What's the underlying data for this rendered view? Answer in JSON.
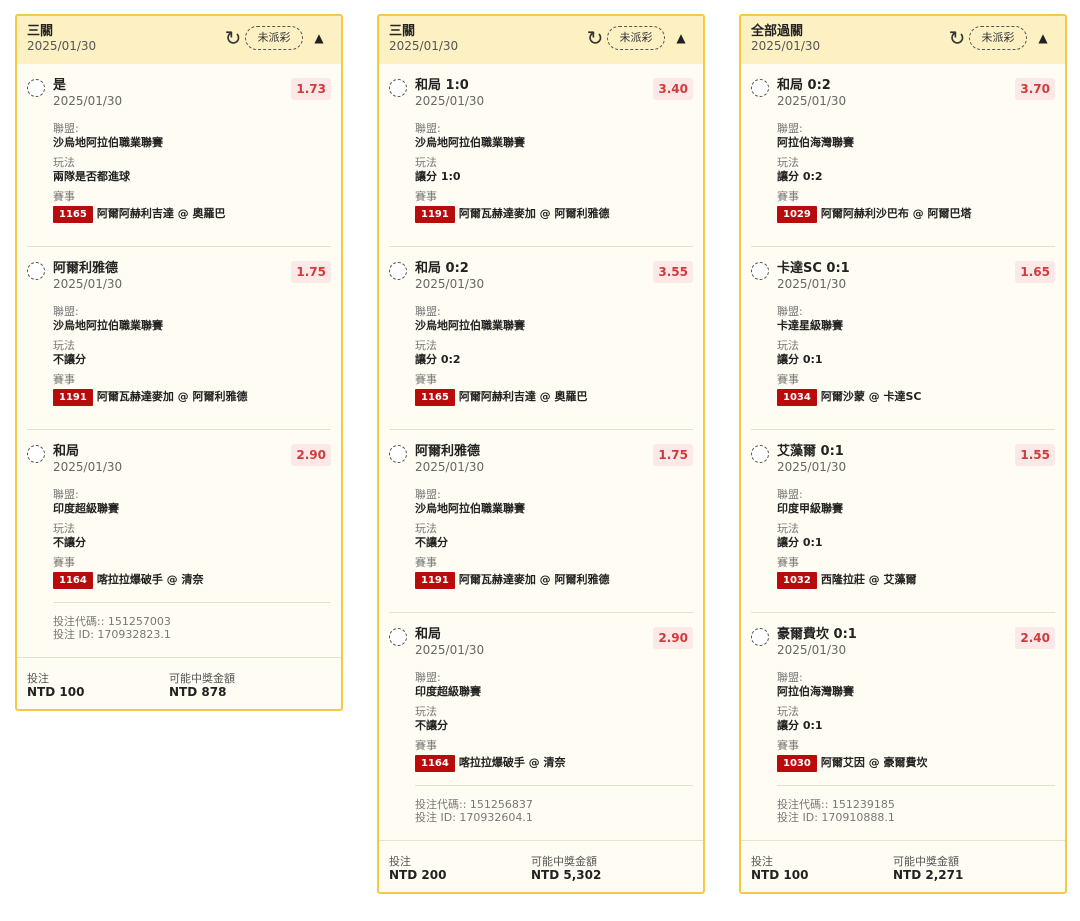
{
  "header_labels": {
    "status": "未派彩",
    "refresh_icon": "refresh-icon",
    "collapse_icon": "chevron-up-icon"
  },
  "labels": {
    "league": "聯盟:",
    "play": "玩法",
    "match": "賽事",
    "stake": "投注",
    "potential": "可能中獎金額"
  },
  "colors": {
    "border": "#f6c945",
    "header_bg": "#fdf1c4",
    "odds_text": "#d13b3b",
    "odds_bg": "#fde8e8",
    "match_id_bg": "#b80c0c"
  },
  "cards": [
    {
      "title": "三關",
      "date": "2025/01/30",
      "selections": [
        {
          "name": "是",
          "date": "2025/01/30",
          "odds": "1.73",
          "league": "沙烏地阿拉伯職業聯賽",
          "play": "兩隊是否都進球",
          "match_id": "1165",
          "match": "阿爾阿赫利吉達 @ 奧羅巴"
        },
        {
          "name": "阿爾利雅德",
          "date": "2025/01/30",
          "odds": "1.75",
          "league": "沙烏地阿拉伯職業聯賽",
          "play": "不讓分",
          "match_id": "1191",
          "match": "阿爾瓦赫達麥加 @ 阿爾利雅德"
        },
        {
          "name": "和局",
          "date": "2025/01/30",
          "odds": "2.90",
          "league": "印度超級聯賽",
          "play": "不讓分",
          "match_id": "1164",
          "match": "喀拉拉爆破手 @ 清奈"
        }
      ],
      "bet_code": "投注代碼:: 151257003",
      "bet_id": "投注 ID: 170932823.1",
      "stake": "NTD 100",
      "potential": "NTD 878"
    },
    {
      "title": "三關",
      "date": "2025/01/30",
      "selections": [
        {
          "name": "和局 1:0",
          "date": "2025/01/30",
          "odds": "3.40",
          "league": "沙烏地阿拉伯職業聯賽",
          "play": "讓分 1:0",
          "match_id": "1191",
          "match": "阿爾瓦赫達麥加 @ 阿爾利雅德"
        },
        {
          "name": "和局 0:2",
          "date": "2025/01/30",
          "odds": "3.55",
          "league": "沙烏地阿拉伯職業聯賽",
          "play": "讓分 0:2",
          "match_id": "1165",
          "match": "阿爾阿赫利吉達 @ 奧羅巴"
        },
        {
          "name": "阿爾利雅德",
          "date": "2025/01/30",
          "odds": "1.75",
          "league": "沙烏地阿拉伯職業聯賽",
          "play": "不讓分",
          "match_id": "1191",
          "match": "阿爾瓦赫達麥加 @ 阿爾利雅德"
        },
        {
          "name": "和局",
          "date": "2025/01/30",
          "odds": "2.90",
          "league": "印度超級聯賽",
          "play": "不讓分",
          "match_id": "1164",
          "match": "喀拉拉爆破手 @ 清奈"
        }
      ],
      "bet_code": "投注代碼:: 151256837",
      "bet_id": "投注 ID: 170932604.1",
      "stake": "NTD 200",
      "potential": "NTD 5,302"
    },
    {
      "title": "全部過關",
      "date": "2025/01/30",
      "selections": [
        {
          "name": "和局 0:2",
          "date": "2025/01/30",
          "odds": "3.70",
          "league": "阿拉伯海灣聯賽",
          "play": "讓分 0:2",
          "match_id": "1029",
          "match": "阿爾阿赫利沙巴布 @ 阿爾巴塔"
        },
        {
          "name": "卡達SC 0:1",
          "date": "2025/01/30",
          "odds": "1.65",
          "league": "卡達星級聯賽",
          "play": "讓分 0:1",
          "match_id": "1034",
          "match": "阿爾沙蒙 @ 卡達SC"
        },
        {
          "name": "艾藻爾 0:1",
          "date": "2025/01/30",
          "odds": "1.55",
          "league": "印度甲級聯賽",
          "play": "讓分 0:1",
          "match_id": "1032",
          "match": "西隆拉莊 @ 艾藻爾"
        },
        {
          "name": "豪爾費坎 0:1",
          "date": "2025/01/30",
          "odds": "2.40",
          "league": "阿拉伯海灣聯賽",
          "play": "讓分 0:1",
          "match_id": "1030",
          "match": "阿爾艾因 @ 豪爾費坎"
        }
      ],
      "bet_code": "投注代碼:: 151239185",
      "bet_id": "投注 ID: 170910888.1",
      "stake": "NTD 100",
      "potential": "NTD 2,271"
    }
  ]
}
